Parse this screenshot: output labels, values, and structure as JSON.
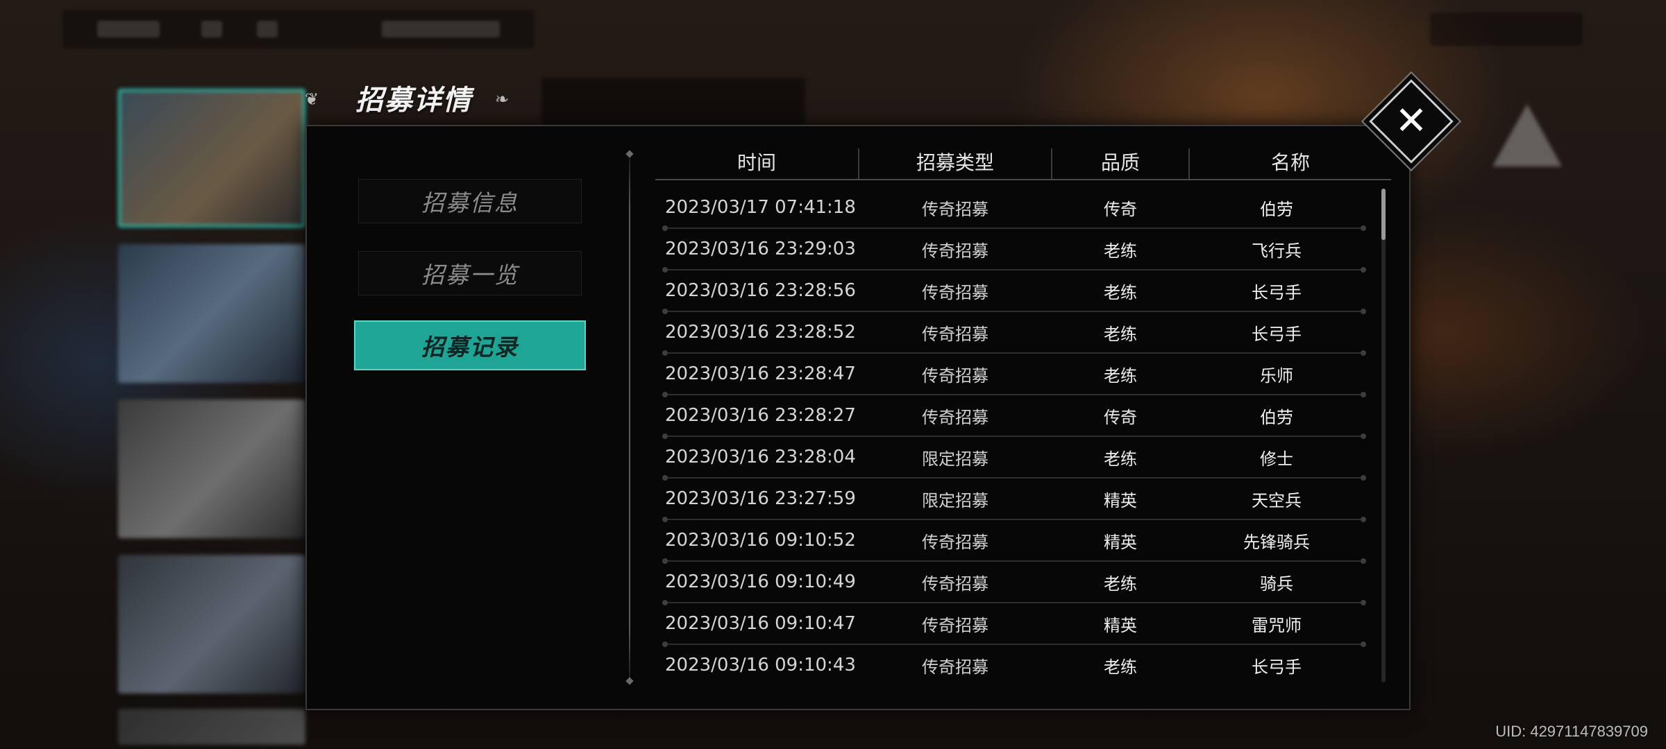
{
  "header": {
    "title": "招募详情",
    "left_icon": "trefoil-left-icon",
    "right_icon": "trefoil-right-icon"
  },
  "close_icon": "close-icon",
  "menu": {
    "items": [
      {
        "label": "招募信息",
        "active": false
      },
      {
        "label": "招募一览",
        "active": false
      },
      {
        "label": "招募记录",
        "active": true
      }
    ]
  },
  "table": {
    "columns": [
      "时间",
      "招募类型",
      "品质",
      "名称"
    ],
    "rows": [
      {
        "time": "2023/03/17  07:41:18",
        "type": "传奇招募",
        "quality": "传奇",
        "name": "伯劳"
      },
      {
        "time": "2023/03/16  23:29:03",
        "type": "传奇招募",
        "quality": "老练",
        "name": "飞行兵"
      },
      {
        "time": "2023/03/16  23:28:56",
        "type": "传奇招募",
        "quality": "老练",
        "name": "长弓手"
      },
      {
        "time": "2023/03/16  23:28:52",
        "type": "传奇招募",
        "quality": "老练",
        "name": "长弓手"
      },
      {
        "time": "2023/03/16  23:28:47",
        "type": "传奇招募",
        "quality": "老练",
        "name": "乐师"
      },
      {
        "time": "2023/03/16  23:28:27",
        "type": "传奇招募",
        "quality": "传奇",
        "name": "伯劳"
      },
      {
        "time": "2023/03/16  23:28:04",
        "type": "限定招募",
        "quality": "老练",
        "name": "修士"
      },
      {
        "time": "2023/03/16  23:27:59",
        "type": "限定招募",
        "quality": "精英",
        "name": "天空兵"
      },
      {
        "time": "2023/03/16  09:10:52",
        "type": "传奇招募",
        "quality": "精英",
        "name": "先锋骑兵"
      },
      {
        "time": "2023/03/16  09:10:49",
        "type": "传奇招募",
        "quality": "老练",
        "name": "骑兵"
      },
      {
        "time": "2023/03/16  09:10:47",
        "type": "传奇招募",
        "quality": "精英",
        "name": "雷咒师"
      },
      {
        "time": "2023/03/16  09:10:43",
        "type": "传奇招募",
        "quality": "老练",
        "name": "长弓手"
      }
    ]
  },
  "uid": "UID: 42971147839709",
  "colors": {
    "accent": "#1fa596",
    "accent_border": "#5fd4c6",
    "panel_bg": "#070707"
  }
}
